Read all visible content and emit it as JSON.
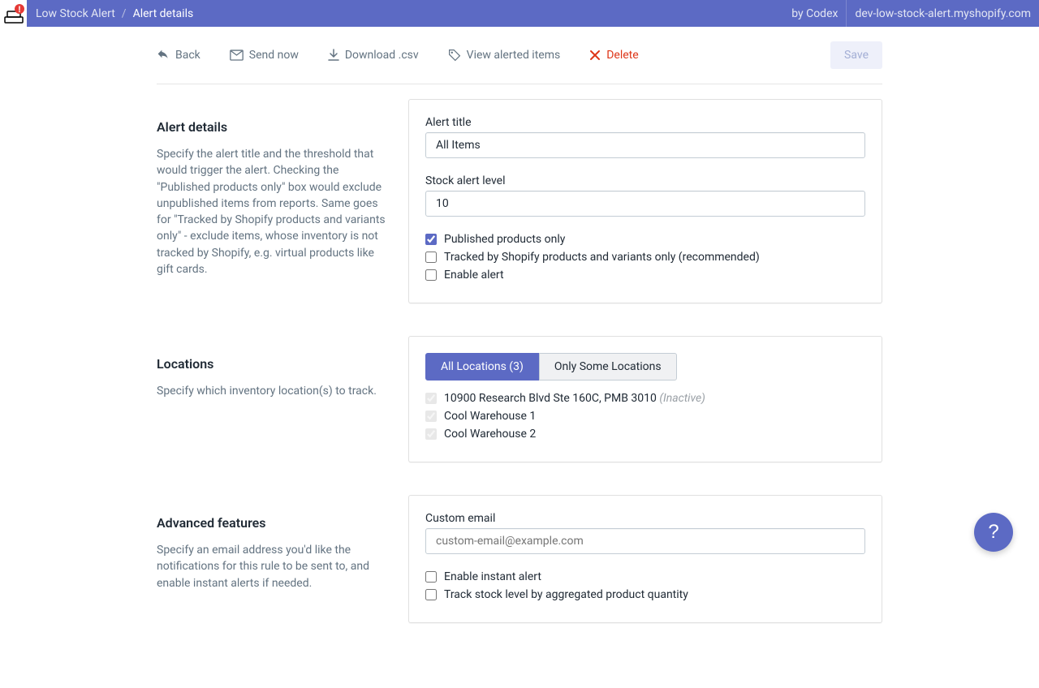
{
  "topbar": {
    "app_name": "Low Stock Alert",
    "separator": "/",
    "page": "Alert details",
    "by": "by Codex",
    "shop": "dev-low-stock-alert.myshopify.com"
  },
  "toolbar": {
    "back": "Back",
    "send_now": "Send now",
    "download_csv": "Download .csv",
    "view_alerted": "View alerted items",
    "delete": "Delete",
    "save": "Save"
  },
  "sections": {
    "details": {
      "title": "Alert details",
      "desc": "Specify the alert title and the threshold that would trigger the alert. Checking the \"Published products only\" box would exclude unpublished items from reports. Same goes for \"Tracked by Shopify products and variants only\" - exclude items, whose inventory is not tracked by Shopify, e.g. virtual products like gift cards.",
      "field_title_label": "Alert title",
      "field_title_value": "All Items",
      "field_level_label": "Stock alert level",
      "field_level_value": "10",
      "cb_published": "Published products only",
      "cb_tracked": "Tracked by Shopify products and variants only (recommended)",
      "cb_enable": "Enable alert"
    },
    "locations": {
      "title": "Locations",
      "desc": "Specify which inventory location(s) to track.",
      "btn_all": "All Locations (3)",
      "btn_some": "Only Some Locations",
      "loc1": "10900 Research Blvd Ste 160C, PMB 3010",
      "loc1_inactive": "(Inactive)",
      "loc2": "Cool Warehouse 1",
      "loc3": "Cool Warehouse 2"
    },
    "advanced": {
      "title": "Advanced features",
      "desc": "Specify an email address you'd like the notifications for this rule to be sent to, and enable instant alerts if needed.",
      "field_email_label": "Custom email",
      "field_email_placeholder": "custom-email@example.com",
      "cb_instant": "Enable instant alert",
      "cb_aggregate": "Track stock level by aggregated product quantity"
    }
  },
  "help": "?"
}
